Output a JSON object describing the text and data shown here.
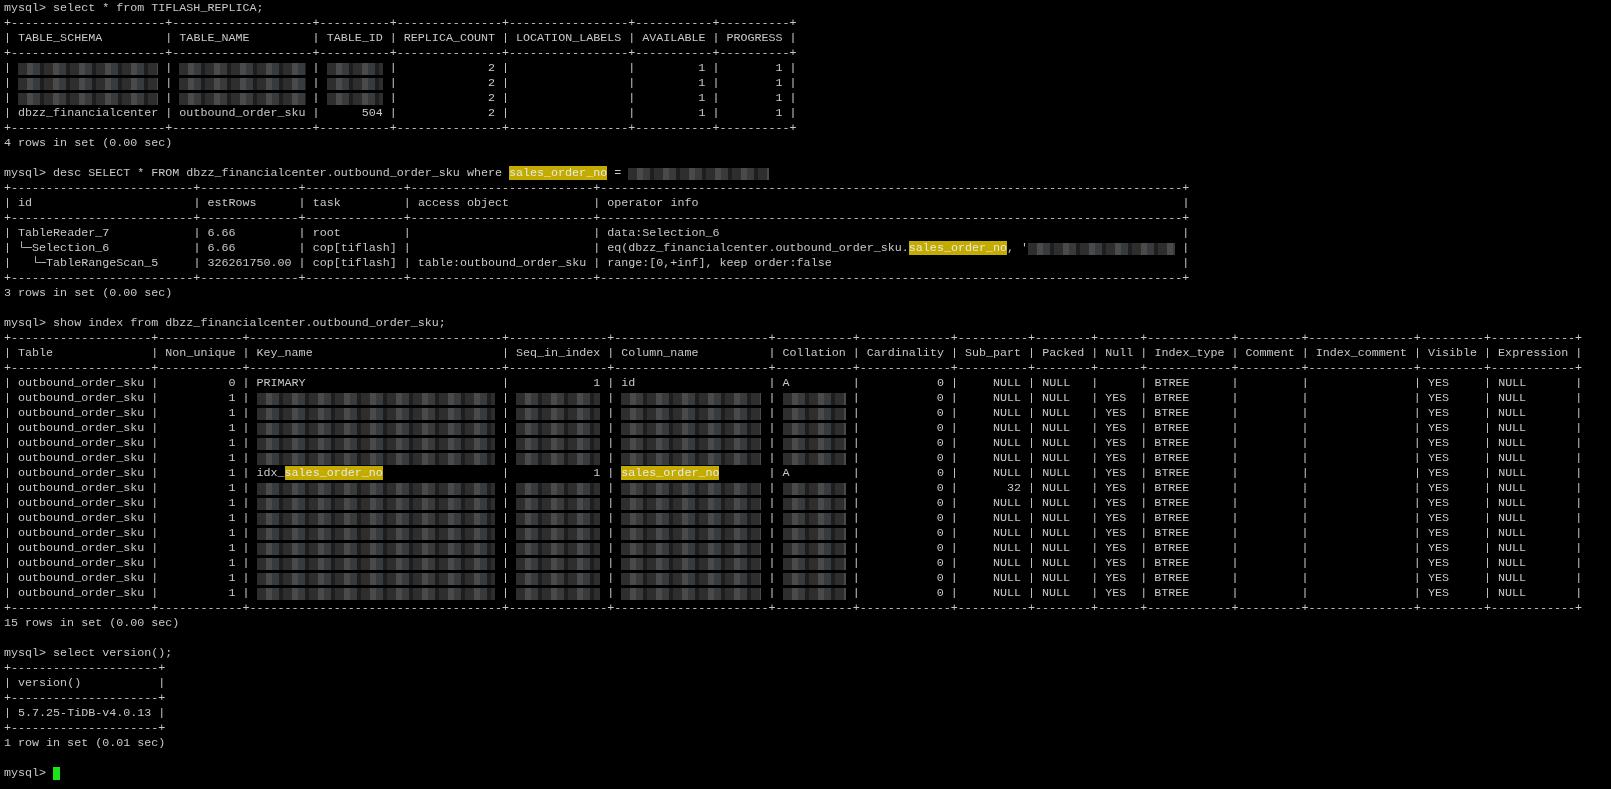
{
  "blocks": [
    {
      "kind": "prompt",
      "parts": [
        {
          "kind": "text",
          "text": "mysql> select * from TIFLASH_REPLICA;"
        }
      ]
    },
    {
      "kind": "table",
      "border": "+----------------------+--------------------+----------+---------------+-----------------+-----------+----------+",
      "separator": "|",
      "headers": [
        "TABLE_SCHEMA",
        "TABLE_NAME",
        "TABLE_ID",
        "REPLICA_COUNT",
        "LOCATION_LABELS",
        "AVAILABLE",
        "PROGRESS"
      ],
      "rows": [
        [
          [
            {
              "kind": "redacted"
            }
          ],
          [
            {
              "kind": "redacted"
            }
          ],
          [
            {
              "kind": "redacted"
            }
          ],
          "            2",
          null,
          "        1",
          "       1"
        ],
        [
          [
            {
              "kind": "redacted"
            }
          ],
          [
            {
              "kind": "redacted"
            }
          ],
          [
            {
              "kind": "redacted"
            }
          ],
          "            2",
          null,
          "        1",
          "       1"
        ],
        [
          [
            {
              "kind": "redacted"
            }
          ],
          [
            {
              "kind": "redacted"
            }
          ],
          [
            {
              "kind": "redacted"
            }
          ],
          "            2",
          null,
          "        1",
          "       1"
        ],
        [
          "dbzz_financialcenter",
          "outbound_order_sku",
          "     504",
          "            2",
          null,
          "        1",
          "       1"
        ]
      ]
    },
    {
      "kind": "status",
      "text": "4 rows in set (0.00 sec)"
    },
    {
      "kind": "blank"
    },
    {
      "kind": "prompt",
      "parts": [
        {
          "kind": "text",
          "text": "mysql> desc SELECT * FROM dbzz_financialcenter.outbound_order_sku where "
        },
        {
          "kind": "mark",
          "text": "sales_order_no"
        },
        {
          "kind": "text",
          "text": " = "
        },
        {
          "kind": "redacted"
        }
      ]
    },
    {
      "kind": "table",
      "border": "+--------------------------+--------------+--------------+--------------------------+-----------------------------------------------------------------------------------+",
      "separator": "|",
      "headers": [
        "id",
        "estRows",
        "task",
        "access object",
        "operator info"
      ],
      "rows": [
        [
          "TableReader_7",
          "6.66",
          "root",
          null,
          "data:Selection_6"
        ],
        [
          "└─Selection_6",
          "6.66",
          "cop[tiflash]",
          null,
          [
            {
              "kind": "text",
              "text": "eq(dbzz_financialcenter.outbound_order_sku."
            },
            {
              "kind": "mark",
              "text": "sales_order_no"
            },
            {
              "kind": "text",
              "text": ", '"
            },
            {
              "kind": "redacted"
            }
          ]
        ],
        [
          "  └─TableRangeScan_5",
          "326261750.00",
          "cop[tiflash]",
          "table:outbound_order_sku",
          "range:[0,+inf], keep order:false"
        ]
      ]
    },
    {
      "kind": "status",
      "text": "3 rows in set (0.00 sec)"
    },
    {
      "kind": "blank"
    },
    {
      "kind": "prompt",
      "parts": [
        {
          "kind": "text",
          "text": "mysql> show index from dbzz_financialcenter.outbound_order_sku;"
        }
      ]
    },
    {
      "kind": "table",
      "border": "+--------------------+------------+------------------------------------+--------------+----------------------+-----------+-------------+----------+--------+------+------------+---------+---------------+---------+------------+",
      "separator": "|",
      "headers": [
        "Table",
        "Non_unique",
        "Key_name",
        "Seq_in_index",
        "Column_name",
        "Collation",
        "Cardinality",
        "Sub_part",
        "Packed",
        "Null",
        "Index_type",
        "Comment",
        "Index_comment",
        "Visible",
        "Expression"
      ],
      "rows": [
        [
          "outbound_order_sku",
          "         0",
          "PRIMARY",
          "           1",
          "id",
          "A",
          "          0",
          "    NULL",
          "NULL",
          null,
          "BTREE",
          null,
          null,
          "YES",
          "NULL"
        ],
        [
          "outbound_order_sku",
          "         1",
          [
            {
              "kind": "redacted"
            }
          ],
          [
            {
              "kind": "redacted"
            }
          ],
          [
            {
              "kind": "redacted"
            }
          ],
          [
            {
              "kind": "redacted"
            }
          ],
          "          0",
          "    NULL",
          "NULL",
          "YES",
          "BTREE",
          null,
          null,
          "YES",
          "NULL"
        ],
        [
          "outbound_order_sku",
          "         1",
          [
            {
              "kind": "redacted"
            }
          ],
          [
            {
              "kind": "redacted"
            }
          ],
          [
            {
              "kind": "redacted"
            }
          ],
          [
            {
              "kind": "redacted"
            }
          ],
          "          0",
          "    NULL",
          "NULL",
          "YES",
          "BTREE",
          null,
          null,
          "YES",
          "NULL"
        ],
        [
          "outbound_order_sku",
          "         1",
          [
            {
              "kind": "redacted"
            }
          ],
          [
            {
              "kind": "redacted"
            }
          ],
          [
            {
              "kind": "redacted"
            }
          ],
          [
            {
              "kind": "redacted"
            }
          ],
          "          0",
          "    NULL",
          "NULL",
          "YES",
          "BTREE",
          null,
          null,
          "YES",
          "NULL"
        ],
        [
          "outbound_order_sku",
          "         1",
          [
            {
              "kind": "redacted"
            }
          ],
          [
            {
              "kind": "redacted"
            }
          ],
          [
            {
              "kind": "redacted"
            }
          ],
          [
            {
              "kind": "redacted"
            }
          ],
          "          0",
          "    NULL",
          "NULL",
          "YES",
          "BTREE",
          null,
          null,
          "YES",
          "NULL"
        ],
        [
          "outbound_order_sku",
          "         1",
          [
            {
              "kind": "redacted"
            }
          ],
          [
            {
              "kind": "redacted"
            }
          ],
          [
            {
              "kind": "redacted"
            }
          ],
          [
            {
              "kind": "redacted"
            }
          ],
          "          0",
          "    NULL",
          "NULL",
          "YES",
          "BTREE",
          null,
          null,
          "YES",
          "NULL"
        ],
        [
          "outbound_order_sku",
          "         1",
          [
            {
              "kind": "text",
              "text": "idx_"
            },
            {
              "kind": "mark",
              "text": "sales_order_no"
            }
          ],
          "           1",
          [
            {
              "kind": "mark",
              "text": "sales_order_no"
            }
          ],
          "A",
          "          0",
          "    NULL",
          "NULL",
          "YES",
          "BTREE",
          null,
          null,
          "YES",
          "NULL"
        ],
        [
          "outbound_order_sku",
          "         1",
          [
            {
              "kind": "redacted"
            }
          ],
          [
            {
              "kind": "redacted"
            }
          ],
          [
            {
              "kind": "redacted"
            }
          ],
          [
            {
              "kind": "redacted"
            }
          ],
          "          0",
          "      32",
          "NULL",
          "YES",
          "BTREE",
          null,
          null,
          "YES",
          "NULL"
        ],
        [
          "outbound_order_sku",
          "         1",
          [
            {
              "kind": "redacted"
            }
          ],
          [
            {
              "kind": "redacted"
            }
          ],
          [
            {
              "kind": "redacted"
            }
          ],
          [
            {
              "kind": "redacted"
            }
          ],
          "          0",
          "    NULL",
          "NULL",
          "YES",
          "BTREE",
          null,
          null,
          "YES",
          "NULL"
        ],
        [
          "outbound_order_sku",
          "         1",
          [
            {
              "kind": "redacted"
            }
          ],
          [
            {
              "kind": "redacted"
            }
          ],
          [
            {
              "kind": "redacted"
            }
          ],
          [
            {
              "kind": "redacted"
            }
          ],
          "          0",
          "    NULL",
          "NULL",
          "YES",
          "BTREE",
          null,
          null,
          "YES",
          "NULL"
        ],
        [
          "outbound_order_sku",
          "         1",
          [
            {
              "kind": "redacted"
            }
          ],
          [
            {
              "kind": "redacted"
            }
          ],
          [
            {
              "kind": "redacted"
            }
          ],
          [
            {
              "kind": "redacted"
            }
          ],
          "          0",
          "    NULL",
          "NULL",
          "YES",
          "BTREE",
          null,
          null,
          "YES",
          "NULL"
        ],
        [
          "outbound_order_sku",
          "         1",
          [
            {
              "kind": "redacted"
            }
          ],
          [
            {
              "kind": "redacted"
            }
          ],
          [
            {
              "kind": "redacted"
            }
          ],
          [
            {
              "kind": "redacted"
            }
          ],
          "          0",
          "    NULL",
          "NULL",
          "YES",
          "BTREE",
          null,
          null,
          "YES",
          "NULL"
        ],
        [
          "outbound_order_sku",
          "         1",
          [
            {
              "kind": "redacted"
            }
          ],
          [
            {
              "kind": "redacted"
            }
          ],
          [
            {
              "kind": "redacted"
            }
          ],
          [
            {
              "kind": "redacted"
            }
          ],
          "          0",
          "    NULL",
          "NULL",
          "YES",
          "BTREE",
          null,
          null,
          "YES",
          "NULL"
        ],
        [
          "outbound_order_sku",
          "         1",
          [
            {
              "kind": "redacted"
            }
          ],
          [
            {
              "kind": "redacted"
            }
          ],
          [
            {
              "kind": "redacted"
            }
          ],
          [
            {
              "kind": "redacted"
            }
          ],
          "          0",
          "    NULL",
          "NULL",
          "YES",
          "BTREE",
          null,
          null,
          "YES",
          "NULL"
        ],
        [
          "outbound_order_sku",
          "         1",
          [
            {
              "kind": "redacted"
            }
          ],
          [
            {
              "kind": "redacted"
            }
          ],
          [
            {
              "kind": "redacted"
            }
          ],
          [
            {
              "kind": "redacted"
            }
          ],
          "          0",
          "    NULL",
          "NULL",
          "YES",
          "BTREE",
          null,
          null,
          "YES",
          "NULL"
        ]
      ]
    },
    {
      "kind": "status",
      "text": "15 rows in set (0.00 sec)"
    },
    {
      "kind": "blank"
    },
    {
      "kind": "prompt",
      "parts": [
        {
          "kind": "text",
          "text": "mysql> select version();"
        }
      ]
    },
    {
      "kind": "table",
      "border": "+---------------------+",
      "separator": "|",
      "headers": [
        "version()"
      ],
      "rows": [
        [
          "5.7.25-TiDB-v4.0.13"
        ]
      ]
    },
    {
      "kind": "status",
      "text": "1 row in set (0.01 sec)"
    },
    {
      "kind": "blank"
    },
    {
      "kind": "prompt",
      "parts": [
        {
          "kind": "text",
          "text": "mysql> "
        }
      ],
      "cursor": true
    }
  ]
}
